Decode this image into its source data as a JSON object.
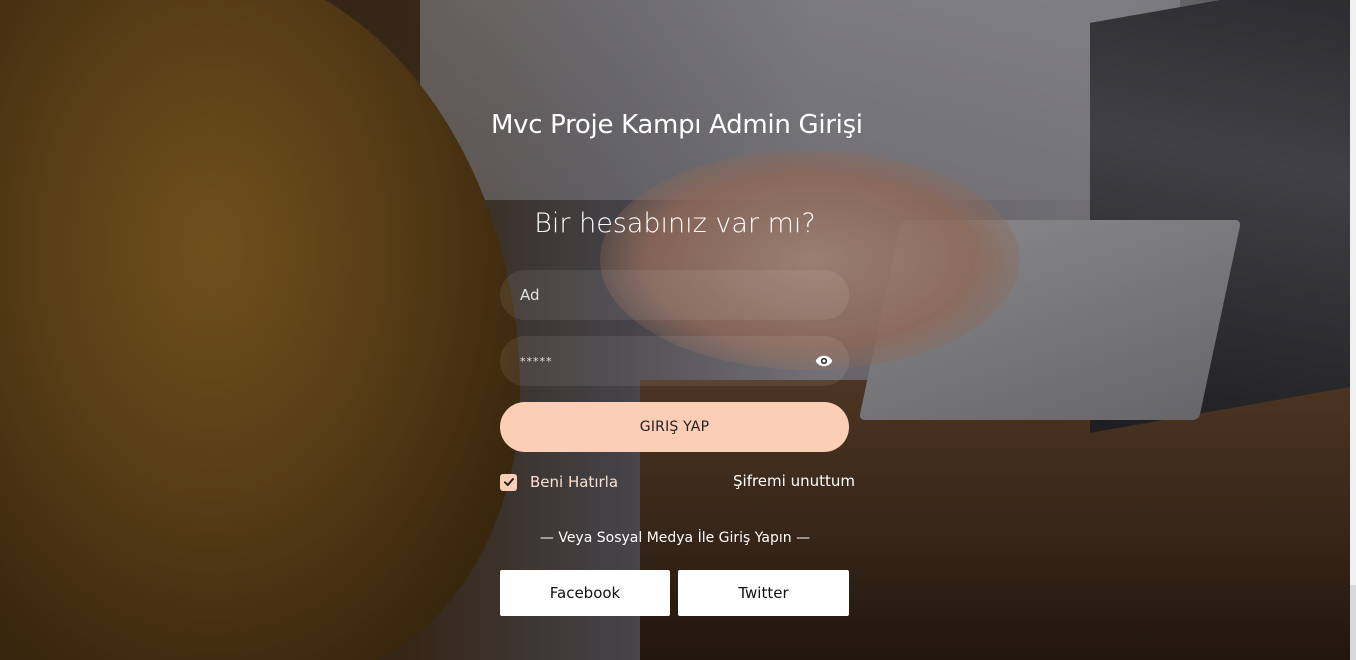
{
  "page": {
    "title": "Mvc Proje Kampı Admin Girişi"
  },
  "form": {
    "heading": "Bir hesabınız var mı?",
    "username_placeholder": "Ad",
    "password_placeholder": "*****",
    "password_toggle_icon": "eye-icon",
    "login_label": "GIRIŞ YAP",
    "remember_label": "Beni Hatırla",
    "remember_checked": true,
    "forgot_label": "Şifremi unuttum"
  },
  "social": {
    "divider_text": "— Veya Sosyal Medya İle Giriş Yapın —",
    "facebook_label": "Facebook",
    "twitter_label": "Twitter"
  },
  "colors": {
    "accent": "#fbceb5",
    "text": "#ffffff",
    "social_button_bg": "#ffffff"
  }
}
